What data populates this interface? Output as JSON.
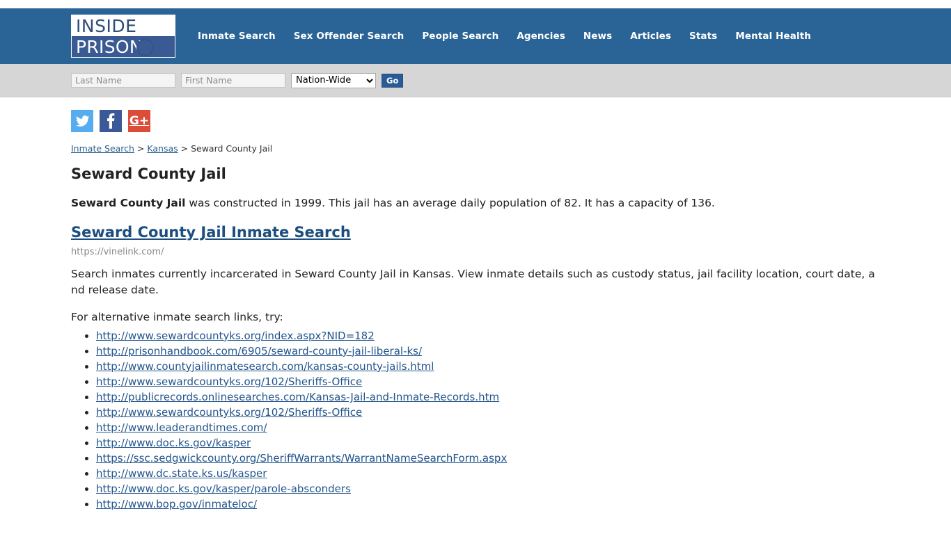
{
  "site": {
    "logo_top": "INSIDE",
    "logo_bottom": "PRISON",
    "header_bg": "#2a6496",
    "searchbar_bg": "#d6d6d6"
  },
  "nav": {
    "items": [
      {
        "label": "Inmate Search"
      },
      {
        "label": "Sex Offender Search"
      },
      {
        "label": "People Search"
      },
      {
        "label": "Agencies"
      },
      {
        "label": "News"
      },
      {
        "label": "Articles"
      },
      {
        "label": "Stats"
      },
      {
        "label": "Mental Health"
      }
    ]
  },
  "search": {
    "last_name_placeholder": "Last Name",
    "last_name_value": "",
    "first_name_placeholder": "First Name",
    "first_name_value": "",
    "scope_selected": "Nation-Wide",
    "scope_options": [
      "Nation-Wide"
    ],
    "go_label": "Go"
  },
  "social": {
    "items": [
      {
        "name": "twitter-icon",
        "label": "Twitter",
        "color": "#55acee"
      },
      {
        "name": "facebook-icon",
        "label": "Facebook",
        "color": "#3b5998"
      },
      {
        "name": "google-plus-icon",
        "label": "Google Plus",
        "color": "#dd4b39",
        "glyph": "G+"
      }
    ]
  },
  "breadcrumb": {
    "item1": "Inmate Search",
    "sep1": " > ",
    "item2": "Kansas",
    "sep2": " > ",
    "current": "Seward County Jail"
  },
  "page": {
    "title": "Seward County Jail",
    "description_bold": "Seward County Jail",
    "description_rest": " was constructed in 1999. This jail has an average daily population of 82. It has a capacity of 136.",
    "constructed_year": "1999",
    "average_daily_population": "82",
    "capacity": "136"
  },
  "result": {
    "heading": "Seward County Jail Inmate Search",
    "url": "https://vinelink.com/",
    "description": "Search inmates currently incarcerated in Seward County Jail in Kansas. View inmate details such as custody status, jail facility location, court date, and release date."
  },
  "alternatives": {
    "intro": "For alternative inmate search links, try:",
    "links": [
      "http://www.sewardcountyks.org/index.aspx?NID=182",
      "http://prisonhandbook.com/6905/seward-county-jail-liberal-ks/",
      "http://www.countyjailinmatesearch.com/kansas-county-jails.html",
      "http://www.sewardcountyks.org/102/Sheriffs-Office",
      "http://publicrecords.onlinesearches.com/Kansas-Jail-and-Inmate-Records.htm",
      "http://www.sewardcountyks.org/102/Sheriffs-Office",
      "http://www.leaderandtimes.com/",
      "http://www.doc.ks.gov/kasper",
      "https://ssc.sedgwickcounty.org/SheriffWarrants/WarrantNameSearchForm.aspx",
      "http://www.dc.state.ks.us/kasper",
      "http://www.doc.ks.gov/kasper/parole-absconders",
      "http://www.bop.gov/inmateloc/"
    ]
  }
}
